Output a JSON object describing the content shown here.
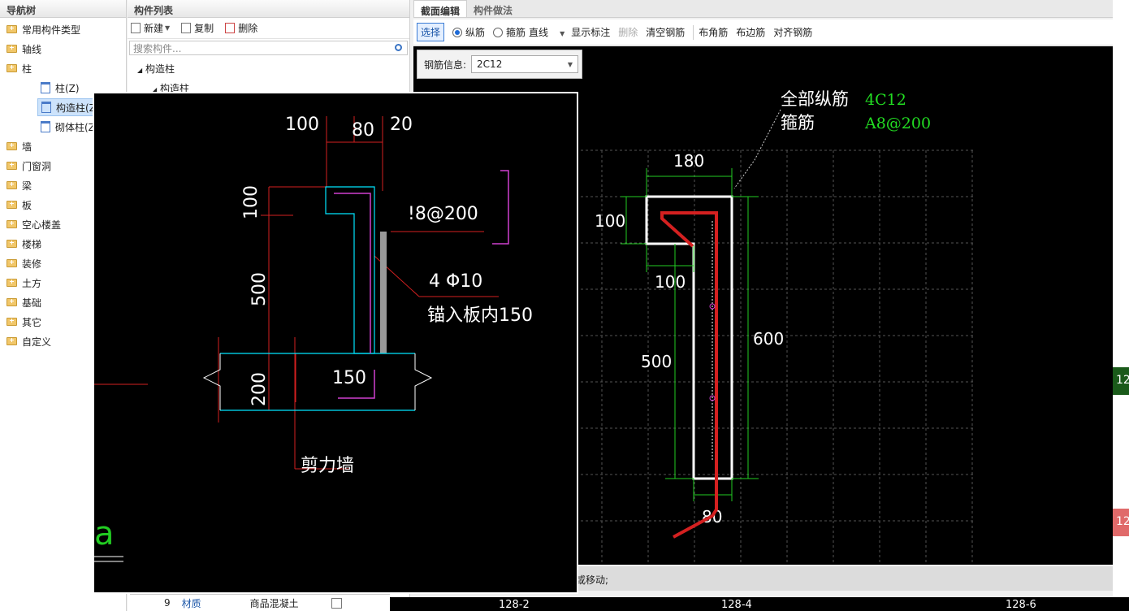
{
  "nav": {
    "title": "导航树",
    "items": [
      {
        "label": "常用构件类型"
      },
      {
        "label": "轴线"
      },
      {
        "label": "柱"
      },
      {
        "label": "柱(Z)"
      },
      {
        "label": "构造柱(Z"
      },
      {
        "label": "砌体柱(Z"
      },
      {
        "label": "墙"
      },
      {
        "label": "门窗洞"
      },
      {
        "label": "梁"
      },
      {
        "label": "板"
      },
      {
        "label": "空心楼盖"
      },
      {
        "label": "楼梯"
      },
      {
        "label": "装修"
      },
      {
        "label": "土方"
      },
      {
        "label": "基础"
      },
      {
        "label": "其它"
      },
      {
        "label": "自定义"
      }
    ]
  },
  "list": {
    "title": "构件列表",
    "toolbar": {
      "new": "新建",
      "copy": "复制",
      "delete": "删除"
    },
    "search_placeholder": "搜索构件...",
    "tree": [
      {
        "label": "构造柱"
      },
      {
        "label": "构造柱"
      }
    ],
    "bottom_row": {
      "index": "9",
      "name": "材质",
      "value": "商品混凝土"
    }
  },
  "editor": {
    "tabs": [
      {
        "label": "截面编辑"
      },
      {
        "label": "构件做法"
      }
    ],
    "toolbar": {
      "select": "选择",
      "longitudinal": "纵筋",
      "stirrup": "箍筋",
      "line": "直线",
      "show_label": "显示标注",
      "delete": "删除",
      "clear": "清空钢筋",
      "corner": "布角筋",
      "edge": "布边筋",
      "align": "对齐钢筋"
    },
    "rebar_info_label": "钢筋信息:",
    "rebar_info_value": "2C12",
    "status": "择钢筋进行编辑，选择标注进行修改或移动;"
  },
  "drawing": {
    "all_long_label": "全部纵筋",
    "all_long_value": "4C12",
    "stirrup_label": "箍筋",
    "stirrup_value": "A8@200",
    "dims": {
      "d180": "180",
      "d100a": "100",
      "d100b": "100",
      "d500": "500",
      "d600": "600",
      "d80": "80"
    }
  },
  "overlay": {
    "d100": "100",
    "d80": "80",
    "d20": "20",
    "d100v": "100",
    "d500": "500",
    "d200": "200",
    "d150": "150",
    "stirrup": "!8@200",
    "long_bars": "4 Φ10",
    "anchor": "锚入板内150",
    "shear_wall": "剪力墙",
    "partial": "a"
  },
  "right": {
    "label1": "12",
    "label2": "12"
  },
  "bottom": {
    "ax1": "128-2",
    "ax2": "128-4",
    "ax3": "128-6"
  },
  "colors": {
    "canvas": "#000000",
    "rebar": "#d42020",
    "dim": "#22cc22",
    "cyan": "#00e5ff",
    "magenta": "#d040d0"
  }
}
